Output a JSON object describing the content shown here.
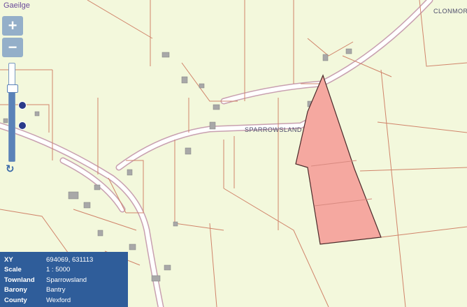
{
  "header": {
    "language_link": "Gaeilge"
  },
  "map_labels": {
    "sparrowsland": "SPARROWSLAND",
    "clonmore": "CLONMOR"
  },
  "controls": {
    "zoom_in": "+",
    "zoom_out": "−",
    "zoom_level_fraction": 0.75,
    "refresh_icon": "↻"
  },
  "info": {
    "rows": [
      {
        "key": "XY",
        "value": "694069, 631113"
      },
      {
        "key": "Scale",
        "value": "1 : 5000"
      },
      {
        "key": "Townland",
        "value": "Sparrowsland"
      },
      {
        "key": "Barony",
        "value": "Bantry"
      },
      {
        "key": "County",
        "value": "Wexford"
      }
    ]
  },
  "colors": {
    "background": "#f3f8dc",
    "boundary": "#d0846a",
    "parcel_fill": "#f5a8a0",
    "parcel_stroke": "#4a2a2a",
    "road": "#ffffff",
    "road_edge": "#c8a0b0",
    "building": "#a8a8a8",
    "panel": "#2f5d9a"
  }
}
